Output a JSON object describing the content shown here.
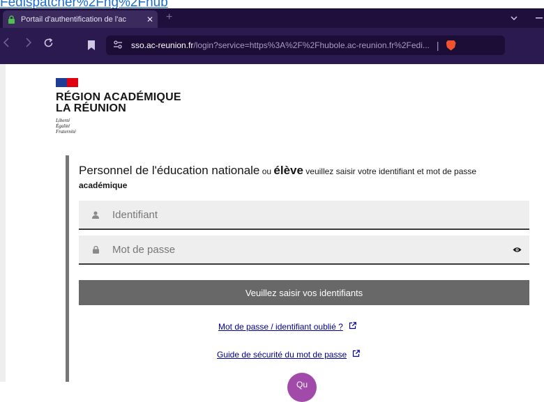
{
  "top_link": {
    "text": "Fedispatcher%2Fng%2Fhub"
  },
  "browser": {
    "tab_title": "Portail d'authentification de l'ac",
    "tab_close": "✕",
    "new_tab": "+",
    "url_host": "sso.ac-reunion.fr",
    "url_rest": "/login?service=https%3A%2F%2Fhubole.ac-reunion.fr%2Fedi...",
    "accent": "#2b1a4f"
  },
  "logo": {
    "line1": "RÉGION ACADÉMIQUE",
    "line2": "LA RÉUNION",
    "motto1": "Liberté",
    "motto2": "Égalité",
    "motto3": "Fraternité"
  },
  "form": {
    "intro_part1": "Personnel de l'éducation nationale",
    "intro_part2": " ou ",
    "intro_part3": "élève",
    "intro_part4": " veuillez saisir votre identifiant et mot de passe ",
    "intro_part5": "académique",
    "username_placeholder": "Identifiant",
    "password_placeholder": "Mot de passe",
    "submit_label": "Veuillez saisir vos identifiants",
    "forgot_link": "Mot de passe / identifiant oublié ?",
    "guide_link": "Guide de sécurité du mot de passe",
    "bottom_button_text": "Qu"
  }
}
